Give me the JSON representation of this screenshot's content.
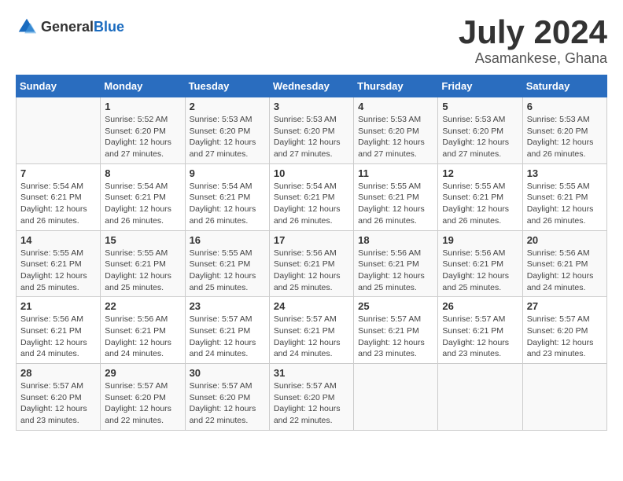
{
  "header": {
    "logo_general": "General",
    "logo_blue": "Blue",
    "month_year": "July 2024",
    "location": "Asamankese, Ghana"
  },
  "calendar": {
    "days_of_week": [
      "Sunday",
      "Monday",
      "Tuesday",
      "Wednesday",
      "Thursday",
      "Friday",
      "Saturday"
    ],
    "weeks": [
      [
        {
          "day": "",
          "info": ""
        },
        {
          "day": "1",
          "info": "Sunrise: 5:52 AM\nSunset: 6:20 PM\nDaylight: 12 hours\nand 27 minutes."
        },
        {
          "day": "2",
          "info": "Sunrise: 5:53 AM\nSunset: 6:20 PM\nDaylight: 12 hours\nand 27 minutes."
        },
        {
          "day": "3",
          "info": "Sunrise: 5:53 AM\nSunset: 6:20 PM\nDaylight: 12 hours\nand 27 minutes."
        },
        {
          "day": "4",
          "info": "Sunrise: 5:53 AM\nSunset: 6:20 PM\nDaylight: 12 hours\nand 27 minutes."
        },
        {
          "day": "5",
          "info": "Sunrise: 5:53 AM\nSunset: 6:20 PM\nDaylight: 12 hours\nand 27 minutes."
        },
        {
          "day": "6",
          "info": "Sunrise: 5:53 AM\nSunset: 6:20 PM\nDaylight: 12 hours\nand 26 minutes."
        }
      ],
      [
        {
          "day": "7",
          "info": "Sunrise: 5:54 AM\nSunset: 6:21 PM\nDaylight: 12 hours\nand 26 minutes."
        },
        {
          "day": "8",
          "info": "Sunrise: 5:54 AM\nSunset: 6:21 PM\nDaylight: 12 hours\nand 26 minutes."
        },
        {
          "day": "9",
          "info": "Sunrise: 5:54 AM\nSunset: 6:21 PM\nDaylight: 12 hours\nand 26 minutes."
        },
        {
          "day": "10",
          "info": "Sunrise: 5:54 AM\nSunset: 6:21 PM\nDaylight: 12 hours\nand 26 minutes."
        },
        {
          "day": "11",
          "info": "Sunrise: 5:55 AM\nSunset: 6:21 PM\nDaylight: 12 hours\nand 26 minutes."
        },
        {
          "day": "12",
          "info": "Sunrise: 5:55 AM\nSunset: 6:21 PM\nDaylight: 12 hours\nand 26 minutes."
        },
        {
          "day": "13",
          "info": "Sunrise: 5:55 AM\nSunset: 6:21 PM\nDaylight: 12 hours\nand 26 minutes."
        }
      ],
      [
        {
          "day": "14",
          "info": "Sunrise: 5:55 AM\nSunset: 6:21 PM\nDaylight: 12 hours\nand 25 minutes."
        },
        {
          "day": "15",
          "info": "Sunrise: 5:55 AM\nSunset: 6:21 PM\nDaylight: 12 hours\nand 25 minutes."
        },
        {
          "day": "16",
          "info": "Sunrise: 5:55 AM\nSunset: 6:21 PM\nDaylight: 12 hours\nand 25 minutes."
        },
        {
          "day": "17",
          "info": "Sunrise: 5:56 AM\nSunset: 6:21 PM\nDaylight: 12 hours\nand 25 minutes."
        },
        {
          "day": "18",
          "info": "Sunrise: 5:56 AM\nSunset: 6:21 PM\nDaylight: 12 hours\nand 25 minutes."
        },
        {
          "day": "19",
          "info": "Sunrise: 5:56 AM\nSunset: 6:21 PM\nDaylight: 12 hours\nand 25 minutes."
        },
        {
          "day": "20",
          "info": "Sunrise: 5:56 AM\nSunset: 6:21 PM\nDaylight: 12 hours\nand 24 minutes."
        }
      ],
      [
        {
          "day": "21",
          "info": "Sunrise: 5:56 AM\nSunset: 6:21 PM\nDaylight: 12 hours\nand 24 minutes."
        },
        {
          "day": "22",
          "info": "Sunrise: 5:56 AM\nSunset: 6:21 PM\nDaylight: 12 hours\nand 24 minutes."
        },
        {
          "day": "23",
          "info": "Sunrise: 5:57 AM\nSunset: 6:21 PM\nDaylight: 12 hours\nand 24 minutes."
        },
        {
          "day": "24",
          "info": "Sunrise: 5:57 AM\nSunset: 6:21 PM\nDaylight: 12 hours\nand 24 minutes."
        },
        {
          "day": "25",
          "info": "Sunrise: 5:57 AM\nSunset: 6:21 PM\nDaylight: 12 hours\nand 23 minutes."
        },
        {
          "day": "26",
          "info": "Sunrise: 5:57 AM\nSunset: 6:21 PM\nDaylight: 12 hours\nand 23 minutes."
        },
        {
          "day": "27",
          "info": "Sunrise: 5:57 AM\nSunset: 6:20 PM\nDaylight: 12 hours\nand 23 minutes."
        }
      ],
      [
        {
          "day": "28",
          "info": "Sunrise: 5:57 AM\nSunset: 6:20 PM\nDaylight: 12 hours\nand 23 minutes."
        },
        {
          "day": "29",
          "info": "Sunrise: 5:57 AM\nSunset: 6:20 PM\nDaylight: 12 hours\nand 22 minutes."
        },
        {
          "day": "30",
          "info": "Sunrise: 5:57 AM\nSunset: 6:20 PM\nDaylight: 12 hours\nand 22 minutes."
        },
        {
          "day": "31",
          "info": "Sunrise: 5:57 AM\nSunset: 6:20 PM\nDaylight: 12 hours\nand 22 minutes."
        },
        {
          "day": "",
          "info": ""
        },
        {
          "day": "",
          "info": ""
        },
        {
          "day": "",
          "info": ""
        }
      ]
    ]
  }
}
